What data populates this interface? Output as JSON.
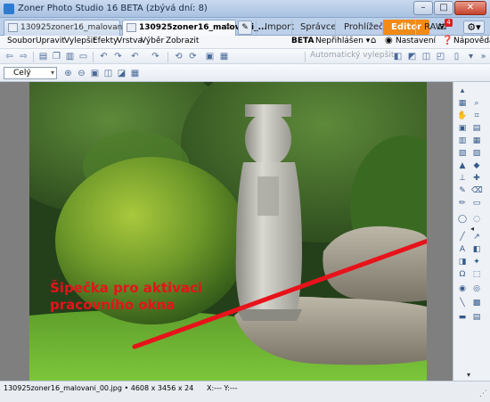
{
  "window": {
    "title": "Zoner Photo Studio 16 BETA (zbývá dní: 8)",
    "minimize": "–",
    "maximize": "□",
    "close": "✕"
  },
  "tabs": {
    "doc1": "130925zoner16_malovani",
    "doc2": "130925zoner16_malovani_...",
    "close": "×",
    "modes": [
      "Import",
      "Správce",
      "Prohlížeč",
      "Editor",
      "RAW"
    ],
    "notifications": "4"
  },
  "menu": {
    "items": [
      "Soubor",
      "Upravit",
      "Vylepšit",
      "Efekty",
      "Vrstva",
      "Výběr",
      "Zobrazit"
    ],
    "beta": "BETA",
    "login": "Nepřihlášen ▾",
    "settings": "Nastavení",
    "help": "Nápověda"
  },
  "toolbar": {
    "auto_enhance": "Automatický vylepšit",
    "zoom": "Celý"
  },
  "annotation": {
    "text": "Šipečka pro aktivaci pracovního okna",
    "color": "#e8121a"
  },
  "status": {
    "file": "130925zoner16_malovani_00.jpg • 4608 x 3456 x 24",
    "coords": "X:--- Y:---"
  },
  "colors": {
    "accent": "#f28a16",
    "titlebar": "#bcd0e9"
  }
}
